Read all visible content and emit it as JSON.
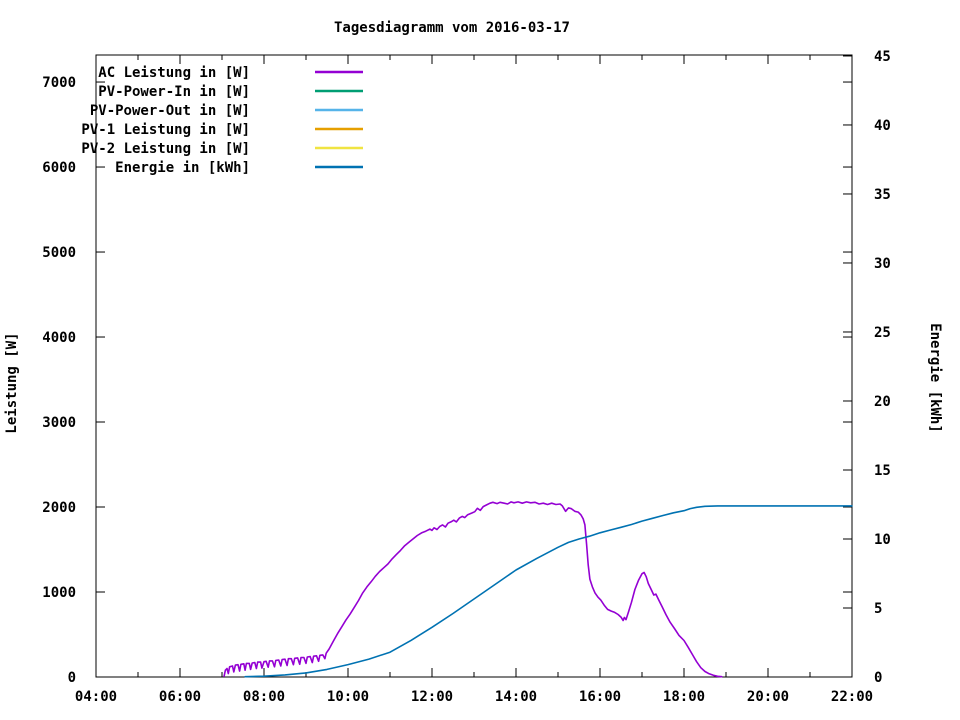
{
  "title": "Tagesdiagramm vom 2016-03-17",
  "colors": {
    "background": "#ffffff",
    "axis": "#000000",
    "ac": "#9400d3",
    "pv_power_in": "#009e73",
    "pv_power_out": "#56b4e9",
    "pv1": "#e69f00",
    "pv2": "#f0e442",
    "energie": "#0072b2"
  },
  "chart_data": {
    "type": "line",
    "title": "Tagesdiagramm vom 2016-03-17",
    "xlabel": "",
    "ylabel": "Leistung [W]",
    "y2label": "Energie [kWh]",
    "grid": false,
    "legend_position": "top-left-inside",
    "xlim_hours": [
      4,
      22
    ],
    "x_ticks": [
      "04:00",
      "06:00",
      "08:00",
      "10:00",
      "12:00",
      "14:00",
      "16:00",
      "18:00",
      "20:00",
      "22:00"
    ],
    "x_tick_hours": [
      4,
      6,
      8,
      10,
      12,
      14,
      16,
      18,
      20,
      22
    ],
    "x_minor_hours": [
      5,
      7,
      9,
      11,
      13,
      15,
      17,
      19,
      21
    ],
    "ylim_left": [
      0,
      7318
    ],
    "y_ticks_left": [
      0,
      1000,
      2000,
      3000,
      4000,
      5000,
      6000,
      7000
    ],
    "ylim_right": [
      0,
      45.07
    ],
    "y_ticks_right": [
      0,
      5,
      10,
      15,
      20,
      25,
      30,
      35,
      40,
      45
    ],
    "series": [
      {
        "name": "AC Leistung in [W]",
        "color": "#9400d3",
        "axis": "left",
        "points": [
          [
            7.05,
            10
          ],
          [
            7.08,
            80
          ],
          [
            7.12,
            100
          ],
          [
            7.15,
            40
          ],
          [
            7.18,
            120
          ],
          [
            7.25,
            130
          ],
          [
            7.28,
            60
          ],
          [
            7.32,
            140
          ],
          [
            7.38,
            145
          ],
          [
            7.42,
            70
          ],
          [
            7.45,
            150
          ],
          [
            7.52,
            155
          ],
          [
            7.55,
            80
          ],
          [
            7.58,
            160
          ],
          [
            7.65,
            160
          ],
          [
            7.68,
            90
          ],
          [
            7.72,
            165
          ],
          [
            7.78,
            170
          ],
          [
            7.82,
            100
          ],
          [
            7.85,
            175
          ],
          [
            7.92,
            175
          ],
          [
            7.95,
            105
          ],
          [
            8.0,
            180
          ],
          [
            8.05,
            185
          ],
          [
            8.1,
            115
          ],
          [
            8.13,
            190
          ],
          [
            8.2,
            190
          ],
          [
            8.25,
            120
          ],
          [
            8.28,
            195
          ],
          [
            8.35,
            200
          ],
          [
            8.4,
            130
          ],
          [
            8.43,
            205
          ],
          [
            8.5,
            210
          ],
          [
            8.55,
            135
          ],
          [
            8.58,
            215
          ],
          [
            8.65,
            215
          ],
          [
            8.7,
            145
          ],
          [
            8.73,
            220
          ],
          [
            8.8,
            225
          ],
          [
            8.85,
            150
          ],
          [
            8.88,
            230
          ],
          [
            8.95,
            230
          ],
          [
            9.0,
            160
          ],
          [
            9.03,
            235
          ],
          [
            9.1,
            240
          ],
          [
            9.15,
            170
          ],
          [
            9.18,
            245
          ],
          [
            9.25,
            250
          ],
          [
            9.3,
            185
          ],
          [
            9.33,
            255
          ],
          [
            9.4,
            260
          ],
          [
            9.45,
            215
          ],
          [
            9.48,
            280
          ],
          [
            9.55,
            330
          ],
          [
            9.65,
            420
          ],
          [
            9.75,
            510
          ],
          [
            9.85,
            590
          ],
          [
            9.95,
            670
          ],
          [
            10.05,
            740
          ],
          [
            10.15,
            820
          ],
          [
            10.25,
            900
          ],
          [
            10.35,
            990
          ],
          [
            10.45,
            1060
          ],
          [
            10.55,
            1120
          ],
          [
            10.65,
            1185
          ],
          [
            10.75,
            1240
          ],
          [
            10.85,
            1285
          ],
          [
            10.95,
            1330
          ],
          [
            11.05,
            1390
          ],
          [
            11.15,
            1440
          ],
          [
            11.25,
            1490
          ],
          [
            11.35,
            1545
          ],
          [
            11.45,
            1585
          ],
          [
            11.55,
            1625
          ],
          [
            11.65,
            1665
          ],
          [
            11.75,
            1695
          ],
          [
            11.85,
            1715
          ],
          [
            11.95,
            1740
          ],
          [
            12.0,
            1725
          ],
          [
            12.05,
            1755
          ],
          [
            12.12,
            1735
          ],
          [
            12.18,
            1770
          ],
          [
            12.25,
            1790
          ],
          [
            12.32,
            1765
          ],
          [
            12.38,
            1810
          ],
          [
            12.45,
            1825
          ],
          [
            12.52,
            1845
          ],
          [
            12.58,
            1825
          ],
          [
            12.65,
            1870
          ],
          [
            12.72,
            1890
          ],
          [
            12.78,
            1875
          ],
          [
            12.85,
            1910
          ],
          [
            12.95,
            1930
          ],
          [
            13.02,
            1945
          ],
          [
            13.08,
            1985
          ],
          [
            13.15,
            1960
          ],
          [
            13.22,
            2005
          ],
          [
            13.3,
            2025
          ],
          [
            13.38,
            2045
          ],
          [
            13.45,
            2055
          ],
          [
            13.55,
            2040
          ],
          [
            13.62,
            2055
          ],
          [
            13.72,
            2045
          ],
          [
            13.8,
            2035
          ],
          [
            13.88,
            2060
          ],
          [
            13.95,
            2050
          ],
          [
            14.05,
            2060
          ],
          [
            14.15,
            2045
          ],
          [
            14.25,
            2060
          ],
          [
            14.35,
            2050
          ],
          [
            14.45,
            2055
          ],
          [
            14.55,
            2035
          ],
          [
            14.65,
            2045
          ],
          [
            14.75,
            2030
          ],
          [
            14.85,
            2045
          ],
          [
            14.95,
            2030
          ],
          [
            15.05,
            2035
          ],
          [
            15.1,
            2015
          ],
          [
            15.18,
            1950
          ],
          [
            15.25,
            1990
          ],
          [
            15.32,
            1980
          ],
          [
            15.4,
            1950
          ],
          [
            15.48,
            1940
          ],
          [
            15.55,
            1905
          ],
          [
            15.6,
            1860
          ],
          [
            15.64,
            1790
          ],
          [
            15.68,
            1560
          ],
          [
            15.72,
            1320
          ],
          [
            15.76,
            1150
          ],
          [
            15.82,
            1060
          ],
          [
            15.88,
            990
          ],
          [
            15.95,
            940
          ],
          [
            16.02,
            905
          ],
          [
            16.1,
            845
          ],
          [
            16.18,
            795
          ],
          [
            16.27,
            775
          ],
          [
            16.35,
            760
          ],
          [
            16.43,
            735
          ],
          [
            16.5,
            705
          ],
          [
            16.55,
            665
          ],
          [
            16.58,
            700
          ],
          [
            16.62,
            675
          ],
          [
            16.68,
            770
          ],
          [
            16.75,
            880
          ],
          [
            16.83,
            1030
          ],
          [
            16.92,
            1140
          ],
          [
            17.0,
            1215
          ],
          [
            17.05,
            1230
          ],
          [
            17.1,
            1180
          ],
          [
            17.15,
            1100
          ],
          [
            17.22,
            1030
          ],
          [
            17.28,
            965
          ],
          [
            17.33,
            975
          ],
          [
            17.4,
            905
          ],
          [
            17.48,
            825
          ],
          [
            17.57,
            735
          ],
          [
            17.67,
            645
          ],
          [
            17.78,
            565
          ],
          [
            17.88,
            490
          ],
          [
            18.0,
            430
          ],
          [
            18.1,
            350
          ],
          [
            18.2,
            265
          ],
          [
            18.3,
            180
          ],
          [
            18.4,
            110
          ],
          [
            18.5,
            65
          ],
          [
            18.6,
            38
          ],
          [
            18.7,
            20
          ],
          [
            18.8,
            8
          ],
          [
            18.9,
            3
          ]
        ]
      },
      {
        "name": "PV-Power-In in [W]",
        "color": "#009e73",
        "axis": "left",
        "points": []
      },
      {
        "name": "PV-Power-Out in [W]",
        "color": "#56b4e9",
        "axis": "left",
        "points": []
      },
      {
        "name": "PV-1 Leistung in [W]",
        "color": "#e69f00",
        "axis": "left",
        "points": []
      },
      {
        "name": "PV-2 Leistung in [W]",
        "color": "#f0e442",
        "axis": "left",
        "points": []
      },
      {
        "name": "Energie in [kWh]",
        "color": "#0072b2",
        "axis": "right",
        "points": [
          [
            7.55,
            0.02
          ],
          [
            8.0,
            0.06
          ],
          [
            8.5,
            0.15
          ],
          [
            9.0,
            0.3
          ],
          [
            9.5,
            0.55
          ],
          [
            10.0,
            0.9
          ],
          [
            10.5,
            1.3
          ],
          [
            11.0,
            1.8
          ],
          [
            11.5,
            2.65
          ],
          [
            12.0,
            3.6
          ],
          [
            12.5,
            4.6
          ],
          [
            13.0,
            5.65
          ],
          [
            13.5,
            6.7
          ],
          [
            14.0,
            7.75
          ],
          [
            14.5,
            8.6
          ],
          [
            15.0,
            9.4
          ],
          [
            15.25,
            9.75
          ],
          [
            15.5,
            10.0
          ],
          [
            15.75,
            10.2
          ],
          [
            16.0,
            10.45
          ],
          [
            16.25,
            10.65
          ],
          [
            16.5,
            10.85
          ],
          [
            16.75,
            11.05
          ],
          [
            17.0,
            11.3
          ],
          [
            17.25,
            11.5
          ],
          [
            17.5,
            11.7
          ],
          [
            17.75,
            11.9
          ],
          [
            18.0,
            12.05
          ],
          [
            18.15,
            12.2
          ],
          [
            18.3,
            12.3
          ],
          [
            18.5,
            12.37
          ],
          [
            18.8,
            12.4
          ],
          [
            19.5,
            12.4
          ],
          [
            20.5,
            12.4
          ],
          [
            21.5,
            12.4
          ],
          [
            22.0,
            12.4
          ]
        ]
      }
    ]
  }
}
